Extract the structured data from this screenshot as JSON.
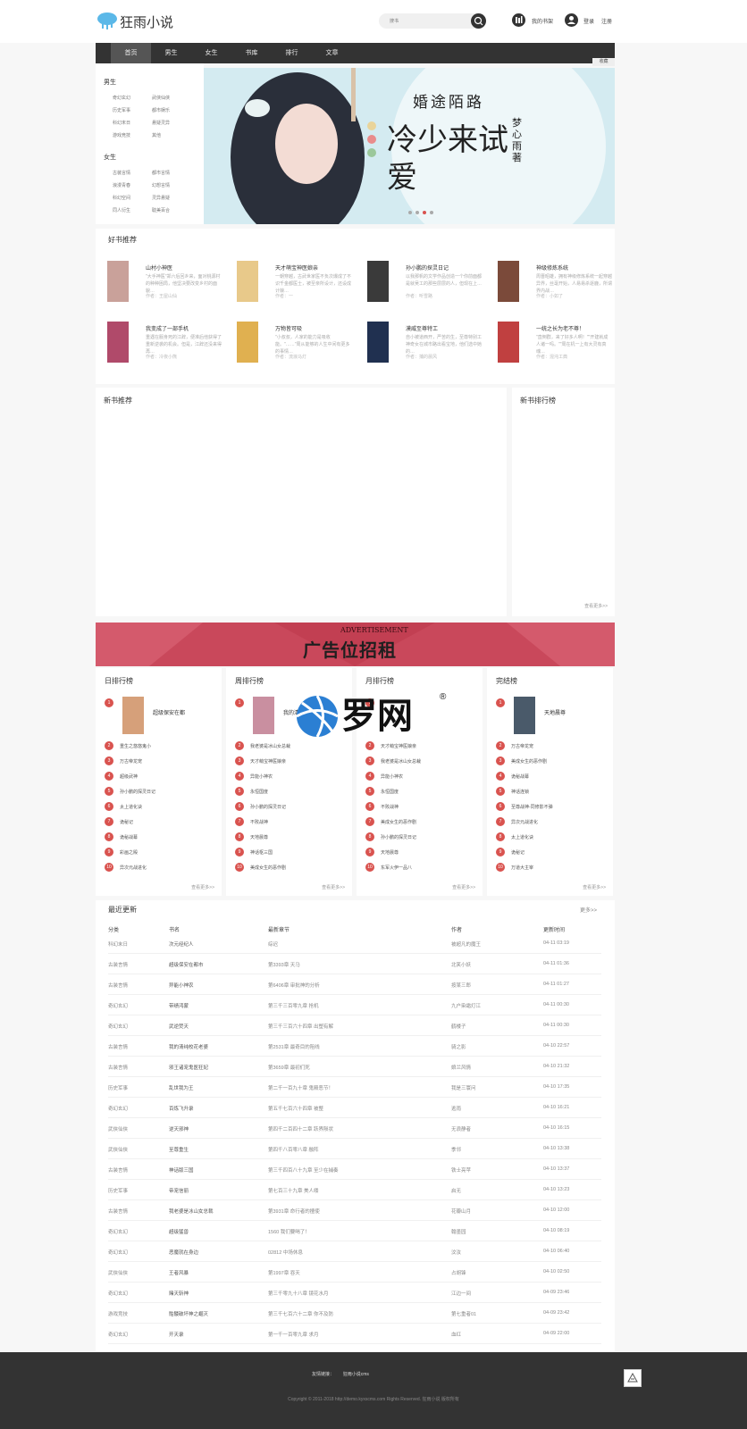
{
  "header": {
    "site_name": "狂雨小说",
    "search_placeholder": "搜书",
    "bookshelf": "我的书架",
    "login": "登录",
    "register": "注册"
  },
  "nav": [
    "首页",
    "男生",
    "女生",
    "书库",
    "排行",
    "文章"
  ],
  "fav": "收藏",
  "categories": {
    "male_title": "男生",
    "male": [
      "奇幻玄幻",
      "武侠仙侠",
      "历史军事",
      "都市娱乐",
      "科幻末日",
      "悬疑灵异",
      "游戏竞技",
      "其他"
    ],
    "female_title": "女生",
    "female": [
      "古装言情",
      "都市言情",
      "浪漫青春",
      "幻想言情",
      "科幻空间",
      "灵异悬疑",
      "同人衍生",
      "耽美百合"
    ]
  },
  "banner": {
    "title": "婚途陌路",
    "big_text": "冷少来试爱",
    "author": "梦心雨著"
  },
  "hot": {
    "title": "好书推荐",
    "books": [
      {
        "t": "山村小神医",
        "d": "\"大手神医\"郑六后回乡来，面对桃源村的种种困局，他坚决要改变乡村的面貌…",
        "a": "作者：王屋山仙"
      },
      {
        "t": "天才萌宝神医娘亲",
        "d": "一朝穿越，古武世家医不负次爆成了不识千金都医士，被至亲所设计，还设成计娘…",
        "a": "作者：一"
      },
      {
        "t": "孙小鹏的探灵日记",
        "d": "以我那帆的文学作品创造一个你前面都是就吴工的那些层层的人，但现在上…",
        "a": "作者：听雪路"
      },
      {
        "t": "神级修炼系统",
        "d": "周晋昭雄，拥有神级修炼系统一起穿越异界，丝毫开始，人易易杀逐鹿，所谓界内战…",
        "a": "作者：小如了"
      },
      {
        "t": "我变成了一部手机",
        "d": "重遇在服身死的江辞，便准后他获得了重新逆袭的机会。但是，江辞还没来得再…",
        "a": "作者：冷夜小熊"
      },
      {
        "t": "万物皆可吸",
        "d": "\"小叔叔，人家的能力是吸收能。\"……\"周从能够的人生中间有更多的事情…",
        "a": "作者：流浪马灯"
      },
      {
        "t": "漠威至尊特工",
        "d": "自小被道西开，严苦的生，至尊特别工神奇女在城市路出看宝地，他们选中她的…",
        "a": "作者：捕的晨风"
      },
      {
        "t": "一统之长为老不尊！",
        "d": "\"直倒群，来了好多人啊！\"\"开建就成人诸一吗。\"\"周在机一上有大灵有真魂…",
        "a": "作者：混沌工典"
      }
    ]
  },
  "newbooks": {
    "title": "新书推荐",
    "rank_title": "新书排行榜",
    "more": "查看更多>>"
  },
  "ad": {
    "small": "ADVERTISEMENT",
    "big": "广告位招租"
  },
  "watermark": {
    "text": "罗网",
    "mark": "®"
  },
  "ranks": [
    {
      "title": "日排行榜",
      "items": [
        "超级保安在都",
        "重生之悠悠鬼小",
        "万古帝龙宠",
        "超级武神",
        "孙小鹏的探灵日记",
        "太上道化诀",
        "诡秘记",
        "诡秘战幕",
        "彩画之殿",
        "异次元战进化"
      ]
    },
    {
      "title": "周排行榜",
      "items": [
        "我的清纯校花",
        "我老婆是冰山女总裁",
        "天才萌宝神医娘亲",
        "异能小神农",
        "永恒国度",
        "孙小鹏的探灵日记",
        "不败战神",
        "天地晨尊",
        "神话枢三国",
        "美成女生的恶作剧"
      ]
    },
    {
      "title": "月排行榜",
      "items": [
        "",
        "天才萌宝神医娘亲",
        "我老婆是冰山女总裁",
        "异能小神农",
        "永恒国度",
        "不败战神",
        "美成女生的恶作剧",
        "孙小鹏的探灵日记",
        "天地晨尊",
        "东军火伊一品八"
      ]
    },
    {
      "title": "完结榜",
      "items": [
        "天地晨尊",
        "万古帝龙宠",
        "美成女生的恶作剧",
        "诡秘战幕",
        "神话连锁",
        "至尊战神-同修影不弹",
        "异次元战进化",
        "太上道化诀",
        "诡秘记",
        "万道大主宰"
      ]
    }
  ],
  "rank_more": "查看更多>>",
  "updates": {
    "title": "最近更新",
    "more": "更多>>",
    "headers": [
      "分类",
      "书名",
      "最新章节",
      "作者",
      "更新时间"
    ],
    "rows": [
      [
        "科幻末日",
        "次元经纪人",
        "综迟",
        "被超凡的魔王",
        "04-11 03:19"
      ],
      [
        "古装言情",
        "超级保安在都市",
        "第3393章 天马",
        "北笑小妖",
        "04-11 01:36"
      ],
      [
        "古装言情",
        "异能小神农",
        "第6406章 审批神的分析",
        "按某三郎",
        "04-11 01:27"
      ],
      [
        "奇幻玄幻",
        "带绩鸿蒙",
        "第三千三百零九章 抢机",
        "九户染霜灯江",
        "04-11 00:30"
      ],
      [
        "奇幻玄幻",
        "武逆焚天",
        "第三千三百六十四章 出塑有解",
        "鹤楼子",
        "04-11 00:30"
      ],
      [
        "古装言情",
        "我的清纯校花老婆",
        "第2531章 最奇目的阻线",
        "骑之影",
        "04-10 22:57"
      ],
      [
        "古装言情",
        "邪王诸宠鬼医狂妃",
        "第3659章 最初们死",
        "娘兰风情",
        "04-10 21:32"
      ],
      [
        "历史军事",
        "乱世我为王",
        "第二千一百九十章 鬼殿恶节！",
        "我是三寰问",
        "04-10 17:35"
      ],
      [
        "奇幻玄幻",
        "百炼飞升录",
        "第五千七百六十四章 被整",
        "逃雨",
        "04-10 16:21"
      ],
      [
        "武侠仙侠",
        "逆天邪神",
        "第四千二百四十二章 跃界陨状",
        "无浪静者",
        "04-10 16:15"
      ],
      [
        "武侠仙侠",
        "至尊重生",
        "第四千八百零八章 融阵",
        "季邻",
        "04-10 13:38"
      ],
      [
        "古装言情",
        "神话版三国",
        "第三千四百八十九章 至少在捕奏",
        "铁士亮苹",
        "04-10 13:37"
      ],
      [
        "历史军事",
        "帝宠信丽",
        "第七百三十九章 美人缕",
        "启无",
        "04-10 13:23"
      ],
      [
        "古装言情",
        "我老婆是冰山女总裁",
        "第3931章 命行者的擅使",
        "花瓣山月",
        "04-10 12:00"
      ],
      [
        "奇幻玄幻",
        "超级猛兽",
        "1560 我们要喝了！",
        "翰墨园",
        "04-10 08:19"
      ],
      [
        "奇幻玄幻",
        "恶魔就在身边",
        "02812 中场休息",
        "汶汝",
        "04-10 06:40"
      ],
      [
        "武侠仙侠",
        "王者风暴",
        "第1997章 吞天",
        "占胡锋",
        "04-10 02:50"
      ],
      [
        "奇幻玄幻",
        "赌天斩神",
        "第三千零九十八章 镜花水月",
        "江边一间",
        "04-09 23:46"
      ],
      [
        "游戏竞技",
        "骷髅破坏神之崛灭",
        "第三千七百六十二章 你不及防",
        "第七重者01",
        "04-09 23:42"
      ],
      [
        "奇幻玄幻",
        "开天录",
        "第一千一百零九章 求月",
        "血红",
        "04-09 22:00"
      ]
    ]
  },
  "footer": {
    "links_label": "友情链接：",
    "link1": "狂雨小说cms",
    "copyright": "Copyright © 2011-2018 http://demo.kyxscms.com Rights Reserved. 狂雨小说 版权所有"
  },
  "colors": {
    "nav": "#333333",
    "accent": "#d9534f",
    "ad": "#c9485b"
  }
}
